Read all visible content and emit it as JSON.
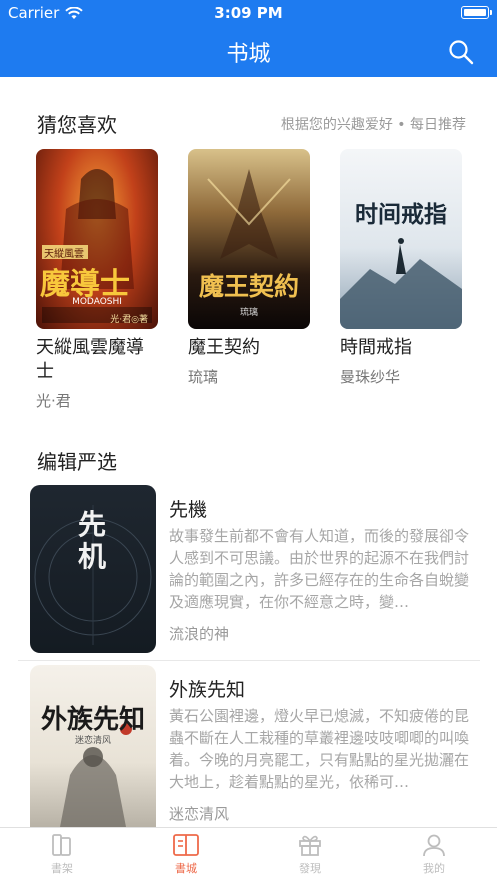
{
  "status_bar": {
    "carrier": "Carrier",
    "time": "3:09 PM"
  },
  "header": {
    "title": "书城"
  },
  "guess": {
    "title": "猜您喜欢",
    "hint": "根据您的兴趣爱好 • 每日推荐",
    "books": [
      {
        "title": "天縱風雲魔導士",
        "author": "光·君",
        "cover_text": "魔導士",
        "cover_sub": "天縱風雲",
        "cover_tag": "MODAOSHI",
        "cover_foot": "光·君◎著"
      },
      {
        "title": "魔王契約",
        "author": "琉璃",
        "cover_text": "魔王契約",
        "cover_foot": "琉璃"
      },
      {
        "title": "時間戒指",
        "author": "曼珠纱华",
        "cover_text": "时间戒指"
      }
    ]
  },
  "editor": {
    "title": "编辑严选",
    "books": [
      {
        "title": "先機",
        "desc": "故事發生前都不會有人知道，而後的發展卻令人感到不可思議。由於世界的起源不在我們討論的範圍之內，許多已經存在的生命各自蛻變及適應現實，在你不經意之時，變…",
        "author": "流浪的神",
        "cover_text": "先机"
      },
      {
        "title": "外族先知",
        "desc": "黃石公園裡邊，燈火早已熄滅，不知疲倦的昆蟲不斷在人工栽種的草叢裡邊吱吱唧唧的叫喚着。今晚的月亮罷工，只有點點的星光拋灑在大地上，趁着點點的星光，依稀可…",
        "author": "迷恋清风",
        "cover_text": "外族先知",
        "cover_sub": "迷恋清风"
      }
    ]
  },
  "tabs": [
    {
      "label": "書架",
      "icon": "bookshelf-icon"
    },
    {
      "label": "書城",
      "icon": "open-book-icon",
      "active": true
    },
    {
      "label": "發現",
      "icon": "gift-icon"
    },
    {
      "label": "我的",
      "icon": "person-icon"
    }
  ],
  "colors": {
    "accent": "#1e7bf0",
    "tab_active": "#ee6a4a"
  }
}
